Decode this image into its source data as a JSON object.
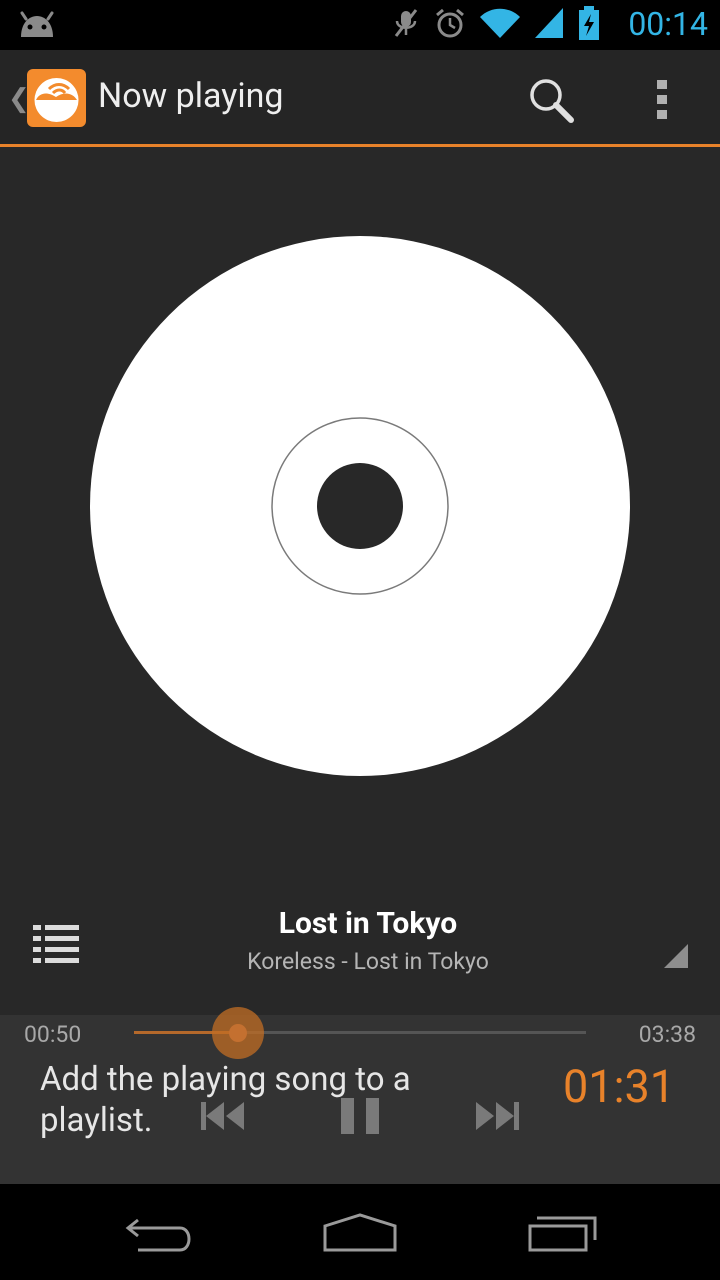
{
  "status_bar": {
    "time": "00:14",
    "notification_icon": "android-icon",
    "status_icons": [
      "mute-icon",
      "alarm-icon",
      "wifi-icon",
      "signal-icon",
      "battery-charging-icon"
    ]
  },
  "action_bar": {
    "title": "Now playing",
    "accent": "#e8822a"
  },
  "now_playing": {
    "album_art": "cd-disc-icon",
    "song_title": "Lost in Tokyo",
    "artist_album": "Koreless - Lost in Tokyo"
  },
  "controls": {
    "elapsed": "00:50",
    "total": "03:38",
    "progress": 0.229,
    "hint_text": "Add the playing song to a playlist.",
    "countdown": "01:31",
    "countdown_color": "#e8822a"
  },
  "nav_bar": {
    "buttons": [
      "back-icon",
      "home-icon",
      "recent-apps-icon"
    ]
  }
}
